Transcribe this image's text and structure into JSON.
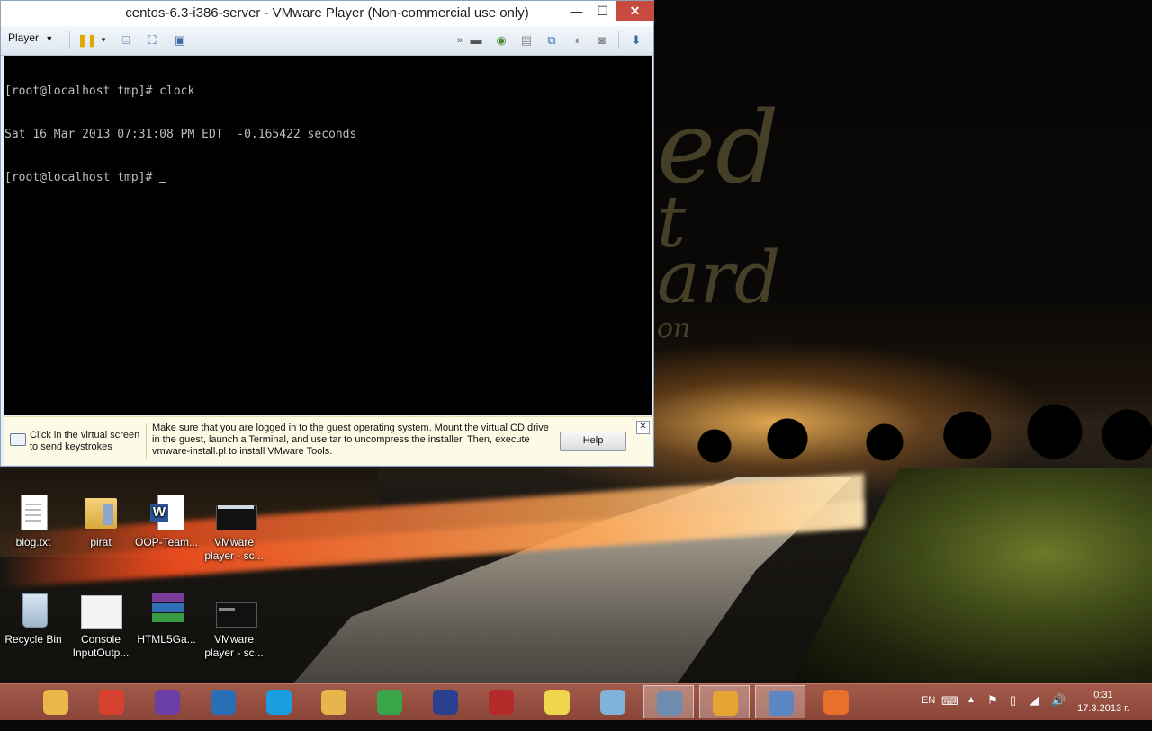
{
  "vm_window": {
    "title": "centos-6.3-i386-server - VMware Player (Non-commercial use only)",
    "minimize": "—",
    "maximize": "☐",
    "close": "✕",
    "toolbar": {
      "player_label": "Player"
    },
    "console_lines": [
      "[root@localhost tmp]# clock",
      "Sat 16 Mar 2013 07:31:08 PM EDT  -0.165422 seconds",
      "[root@localhost tmp]# "
    ],
    "infobar": {
      "click_hint": "Click in the virtual screen to send keystrokes",
      "message": "Make sure that you are logged in to the guest operating system. Mount the virtual CD drive in the guest, launch a Terminal, and use tar to uncompress the installer. Then, execute vmware-install.pl to install VMware Tools.",
      "help_label": "Help"
    }
  },
  "desktop_icons": [
    {
      "label": "blog.txt",
      "icon": "text-file-icon"
    },
    {
      "label": "pirat",
      "icon": "folder-icon"
    },
    {
      "label": "OOP-Team...",
      "icon": "word-document-icon"
    },
    {
      "label": "VMware player - sc...",
      "icon": "screenshot-image-icon"
    },
    {
      "label": "Recycle Bin",
      "icon": "recycle-bin-icon"
    },
    {
      "label": "Console InputOutp...",
      "icon": "image-file-icon"
    },
    {
      "label": "HTML5Ga...",
      "icon": "winrar-archive-icon"
    },
    {
      "label": "VMware player - sc...",
      "icon": "screenshot-image-icon"
    }
  ],
  "taskbar": {
    "items": [
      {
        "name": "file-explorer-icon",
        "color": "#e8b84a"
      },
      {
        "name": "chrome-icon",
        "color": "#d8402f"
      },
      {
        "name": "visual-studio-icon",
        "color": "#6b3fa7"
      },
      {
        "name": "brackets-icon",
        "color": "#2a6fb5"
      },
      {
        "name": "skype-icon",
        "color": "#1b9ee0"
      },
      {
        "name": "winamp-icon",
        "color": "#e6b64c"
      },
      {
        "name": "utorrent-icon",
        "color": "#3aa548"
      },
      {
        "name": "language-flag-icon",
        "color": "#2b3f8f"
      },
      {
        "name": "archive-tool-icon",
        "color": "#b22a2a"
      },
      {
        "name": "sticky-notes-icon",
        "color": "#f0d64a"
      },
      {
        "name": "notepad-icon",
        "color": "#7fb3d9"
      },
      {
        "name": "remote-desktop-icon",
        "color": "#6e8cb0"
      },
      {
        "name": "vmware-icon",
        "color": "#e6a431"
      },
      {
        "name": "paint-icon",
        "color": "#5b86c1"
      },
      {
        "name": "firefox-icon",
        "color": "#e9702a"
      }
    ],
    "tray": {
      "language": "EN",
      "time": "0:31",
      "date": "17.3.2013 г."
    }
  }
}
